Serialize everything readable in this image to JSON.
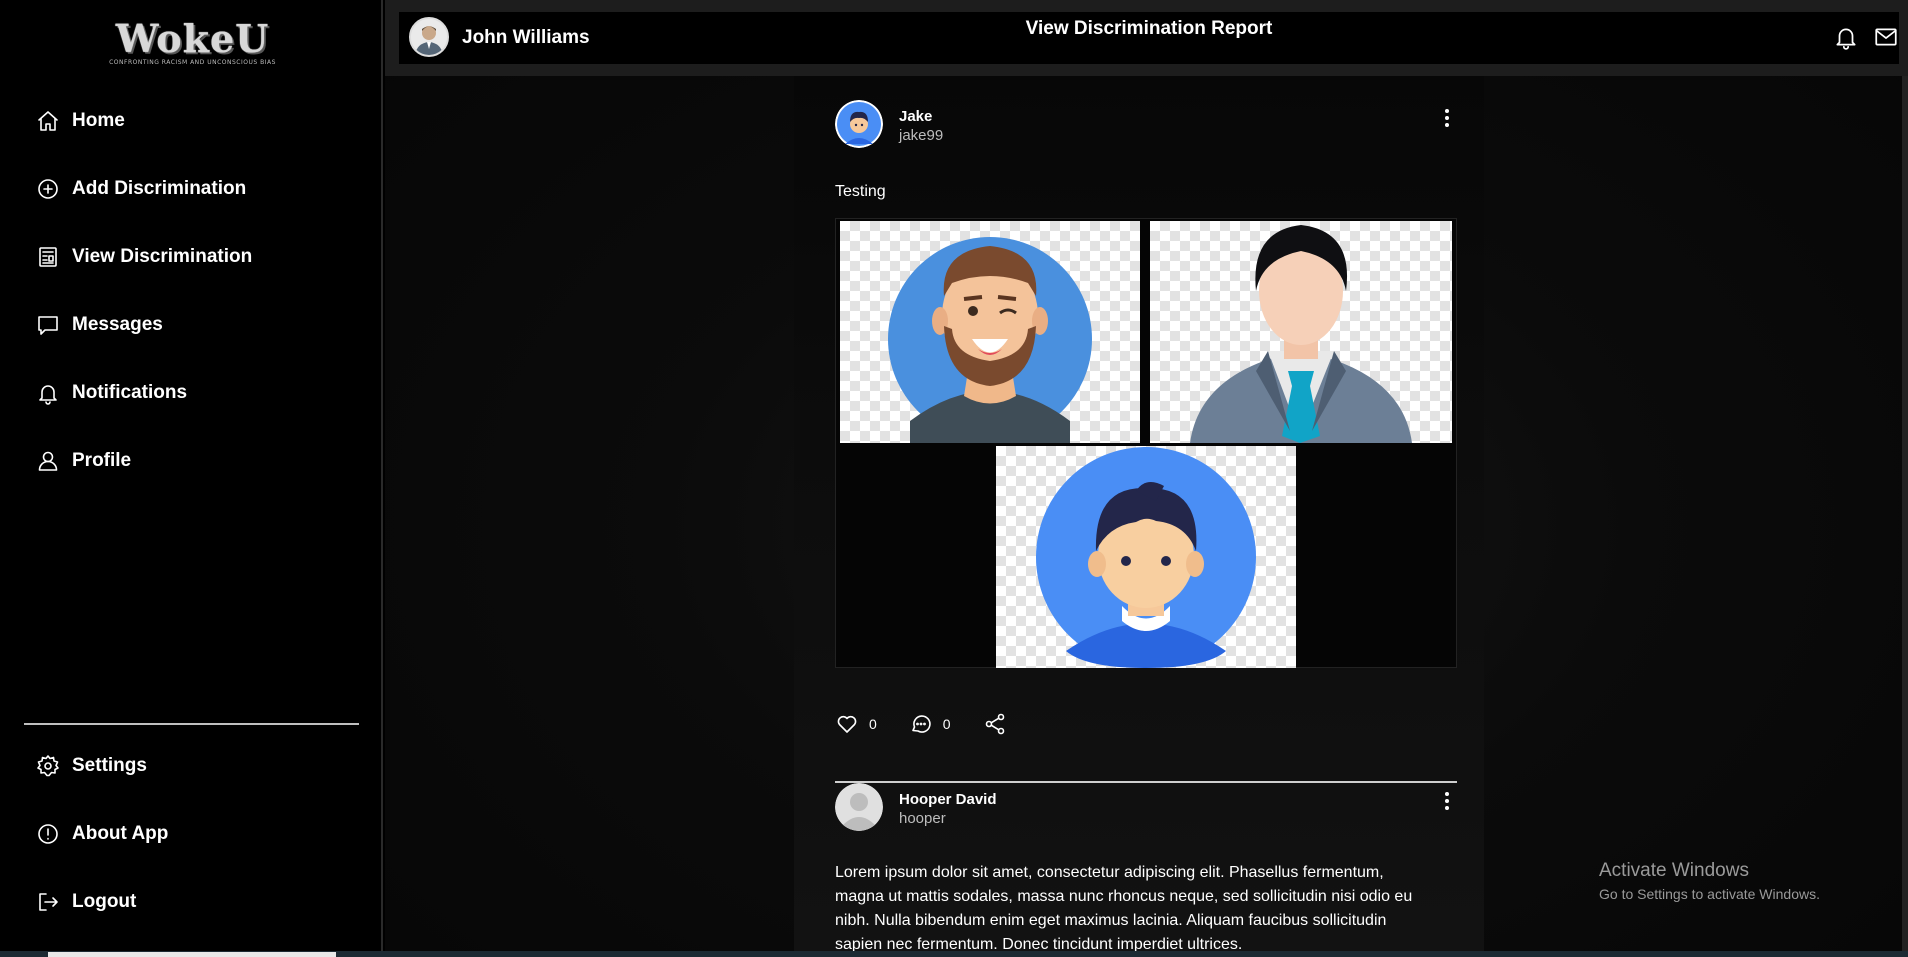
{
  "logo": {
    "name": "WokeU",
    "tagline": "CONFRONTING RACISM AND UNCONSCIOUS BIAS"
  },
  "sidebar": {
    "items": [
      {
        "label": "Home",
        "icon": "home-icon"
      },
      {
        "label": "Add Discrimination",
        "icon": "plus-circle-icon"
      },
      {
        "label": "View Discrimination",
        "icon": "newspaper-icon"
      },
      {
        "label": "Messages",
        "icon": "message-icon"
      },
      {
        "label": "Notifications",
        "icon": "bell-icon"
      },
      {
        "label": "Profile",
        "icon": "user-icon"
      }
    ],
    "bottom_items": [
      {
        "label": "Settings",
        "icon": "gear-icon"
      },
      {
        "label": "About App",
        "icon": "info-icon"
      },
      {
        "label": "Logout",
        "icon": "logout-icon"
      }
    ]
  },
  "header": {
    "user_name": "John Williams",
    "title": "View Discrimination Report"
  },
  "posts": [
    {
      "name": "Jake",
      "handle": "jake99",
      "text": "Testing",
      "likes": "0",
      "comments": "0"
    },
    {
      "name": "Hooper David",
      "handle": "hooper",
      "text_lines": [
        "Lorem ipsum dolor sit amet, consectetur adipiscing elit. Phasellus fermentum,",
        "magna ut mattis sodales, massa nunc rhoncus neque, sed sollicitudin nisi odio eu",
        "nibh. Nulla bibendum enim eget maximus lacinia. Aliquam faucibus sollicitudin",
        "sapien nec fermentum. Donec tincidunt imperdiet ultrices."
      ]
    }
  ],
  "watermark": {
    "line1": "Activate Windows",
    "line2": "Go to Settings to activate Windows."
  },
  "colors": {
    "background": "#000000",
    "text": "#ffffff",
    "divider": "#bfbfbf",
    "avatar_blue": "#4a8ef5"
  }
}
